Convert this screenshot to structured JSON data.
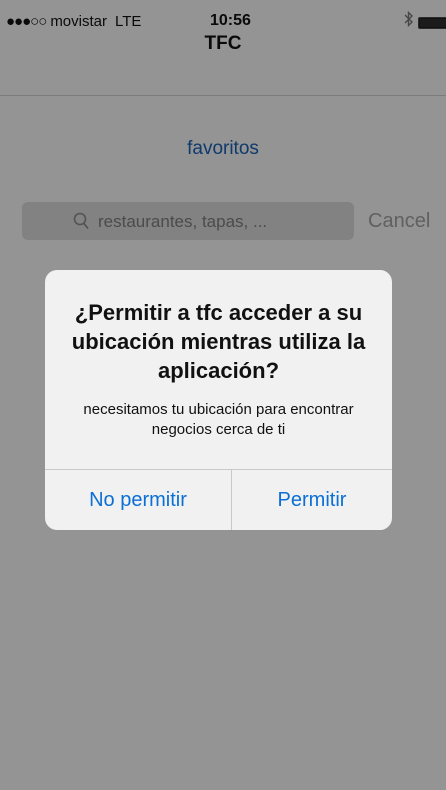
{
  "status_bar": {
    "signal": "●●●○○",
    "carrier": "movistar",
    "network": "LTE",
    "time": "10:56"
  },
  "nav": {
    "title": "TFC"
  },
  "content": {
    "favorites_link": "favoritos",
    "search": {
      "placeholder": "restaurantes, tapas, ..."
    },
    "cancel_label": "Cancel"
  },
  "alert": {
    "title": "¿Permitir a tfc acceder a su ubicación mientras utiliza la aplicación?",
    "message": "necesitamos tu ubicación para encontrar negocios cerca de ti",
    "deny_label": "No permitir",
    "allow_label": "Permitir"
  },
  "colors": {
    "link_blue": "#1a62b5",
    "alert_button_blue": "#0a6fd6",
    "overlay": "rgba(0,0,0,0.40)"
  },
  "icons": [
    "bluetooth-icon",
    "battery-icon",
    "search-icon"
  ]
}
